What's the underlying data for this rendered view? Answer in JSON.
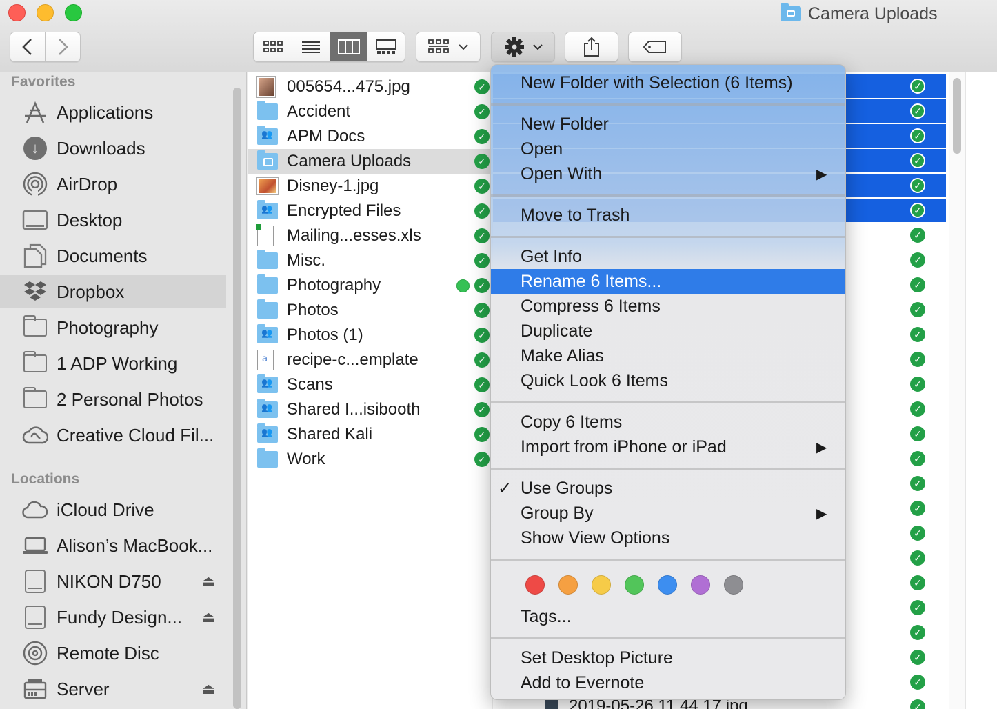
{
  "window": {
    "title": "Camera Uploads"
  },
  "toolbar": {
    "back_icon": "chevron-left-icon",
    "forward_icon": "chevron-right-icon",
    "view_modes": [
      "icon-view",
      "list-view",
      "column-view",
      "gallery-view"
    ],
    "active_view": "column-view",
    "gear_icon": "gear-icon",
    "share_icon": "share-icon",
    "tag_icon": "tag-icon"
  },
  "sidebar": {
    "favorites_header": "Favorites",
    "favorites": [
      {
        "label": "Applications",
        "icon": "applications-icon"
      },
      {
        "label": "Downloads",
        "icon": "downloads-icon"
      },
      {
        "label": "AirDrop",
        "icon": "airdrop-icon"
      },
      {
        "label": "Desktop",
        "icon": "desktop-icon"
      },
      {
        "label": "Documents",
        "icon": "documents-icon"
      },
      {
        "label": "Dropbox",
        "icon": "dropbox-icon",
        "selected": true
      },
      {
        "label": "Photography",
        "icon": "folder-icon"
      },
      {
        "label": "1 ADP Working",
        "icon": "folder-icon"
      },
      {
        "label": "2 Personal Photos",
        "icon": "folder-icon"
      },
      {
        "label": "Creative Cloud Fil...",
        "icon": "creative-cloud-icon"
      }
    ],
    "locations_header": "Locations",
    "locations": [
      {
        "label": "iCloud Drive",
        "icon": "cloud-icon"
      },
      {
        "label": "Alison’s MacBook...",
        "icon": "laptop-icon"
      },
      {
        "label": "NIKON D750",
        "icon": "drive-icon",
        "eject": true
      },
      {
        "label": "Fundy Design...",
        "icon": "drive-icon",
        "eject": true
      },
      {
        "label": "Remote Disc",
        "icon": "disc-icon"
      },
      {
        "label": "Server",
        "icon": "server-icon",
        "eject": true
      }
    ],
    "eject_glyph": "⏏"
  },
  "files": [
    {
      "name": "005654...475.jpg",
      "type": "image"
    },
    {
      "name": "Accident",
      "type": "folder"
    },
    {
      "name": "APM Docs",
      "type": "shared-folder"
    },
    {
      "name": "Camera Uploads",
      "type": "camera-folder",
      "selected": true
    },
    {
      "name": "Disney-1.jpg",
      "type": "image2"
    },
    {
      "name": "Encrypted Files",
      "type": "shared-folder"
    },
    {
      "name": "Mailing...esses.xls",
      "type": "xls"
    },
    {
      "name": "Misc.",
      "type": "folder"
    },
    {
      "name": "Photography",
      "type": "folder",
      "green_tag": true
    },
    {
      "name": "Photos",
      "type": "folder"
    },
    {
      "name": "Photos (1)",
      "type": "shared-folder"
    },
    {
      "name": "recipe-c...emplate",
      "type": "pages"
    },
    {
      "name": "Scans",
      "type": "shared-folder"
    },
    {
      "name": "Shared I...isibooth",
      "type": "shared-folder"
    },
    {
      "name": "Shared Kali",
      "type": "shared-folder"
    },
    {
      "name": "Work",
      "type": "folder"
    }
  ],
  "sync_check_glyph": "✓",
  "right_column": {
    "selected_rows": 6,
    "total_rows": 26,
    "bottom_visible_file": "2019-05-26 11.44.17.jpg"
  },
  "context_menu": {
    "items": [
      {
        "label": "New Folder with Selection (6 Items)"
      },
      {
        "separator": true
      },
      {
        "label": "New Folder"
      },
      {
        "label": "Open"
      },
      {
        "label": "Open With",
        "submenu": true
      },
      {
        "separator": true
      },
      {
        "label": "Move to Trash"
      },
      {
        "separator": true
      },
      {
        "label": "Get Info"
      },
      {
        "label": "Rename 6 Items...",
        "highlighted": true
      },
      {
        "label": "Compress 6 Items"
      },
      {
        "label": "Duplicate"
      },
      {
        "label": "Make Alias"
      },
      {
        "label": "Quick Look 6 Items"
      },
      {
        "separator": true
      },
      {
        "label": "Copy 6 Items"
      },
      {
        "label": "Import from iPhone or iPad",
        "submenu": true
      },
      {
        "separator": true
      },
      {
        "label": "Use Groups",
        "checked": true
      },
      {
        "label": "Group By",
        "submenu": true
      },
      {
        "label": "Show View Options"
      },
      {
        "separator": true
      },
      {
        "tag_colors": [
          "#ee4a46",
          "#f5a042",
          "#f6cb48",
          "#52c55a",
          "#3d8ef0",
          "#b06fd4",
          "#8e8e92"
        ]
      },
      {
        "label": "Tags..."
      },
      {
        "separator": true
      },
      {
        "label": "Set Desktop Picture"
      },
      {
        "label": "Add to Evernote"
      }
    ],
    "submenu_glyph": "▶",
    "check_glyph": "✓"
  }
}
